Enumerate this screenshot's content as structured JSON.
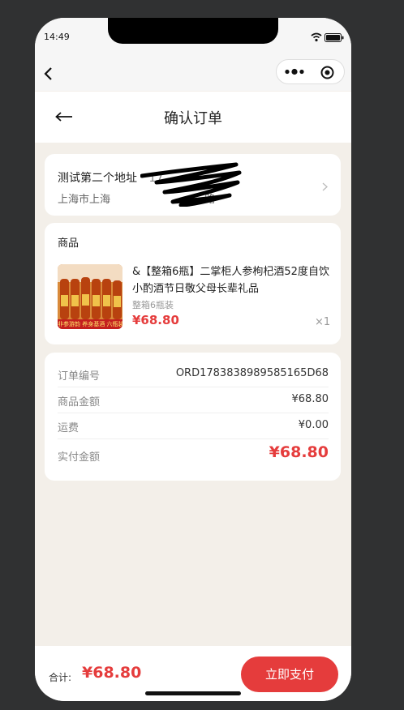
{
  "status_bar": {
    "time": "14:49"
  },
  "header": {
    "title": "确认订单"
  },
  "address": {
    "name_line": "测试第二个地址",
    "name_partial": "17",
    "detail_line": "上海市上海",
    "detail_partial": "路"
  },
  "goods": {
    "section_title": "商品",
    "name": "&【整箱6瓶】二掌柜人参枸杞酒52度自饮小酌酒节日敬父母长辈礼品",
    "spec": "整箱6瓶装",
    "price": "¥68.80",
    "quantity": "×1",
    "thumb_banner": "非参游韵 养身基酒 六瓶装"
  },
  "order_info": {
    "rows": [
      {
        "label": "订单编号",
        "value": "ORD1783838989585165D68"
      },
      {
        "label": "商品金额",
        "value": "¥68.80"
      },
      {
        "label": "运费",
        "value": "¥0.00"
      },
      {
        "label": "实付金额",
        "value": "¥68.80"
      }
    ]
  },
  "footer": {
    "total_label": "合计:",
    "total_value": "¥68.80",
    "pay_button": "立即支付"
  },
  "icons": {
    "back": "chevron-left-icon",
    "arrow": "arrow-left-icon",
    "more": "more-dots-icon",
    "close": "target-circle-icon",
    "wifi": "wifi-icon",
    "battery": "battery-icon",
    "chevron": "chevron-right-icon"
  },
  "colors": {
    "accent": "#e53c3c",
    "page_bg": "#f3efe9",
    "card_bg": "#ffffff"
  }
}
